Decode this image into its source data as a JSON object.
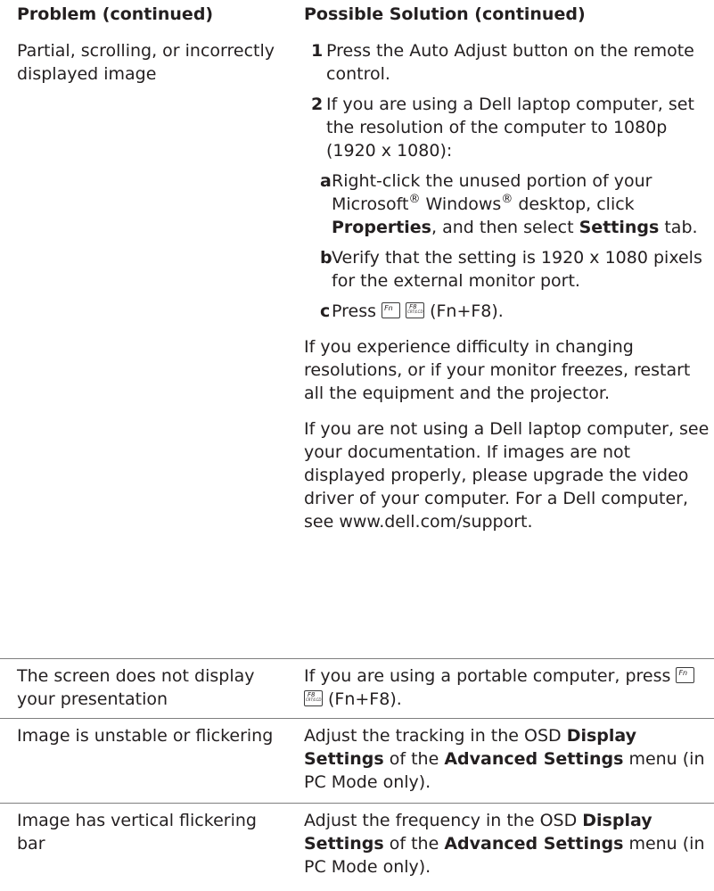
{
  "headers": {
    "problem": "Problem (continued)",
    "solution": "Possible Solution (continued)"
  },
  "rows": [
    {
      "problem": "Partial, scrolling, or incorrectly displayed image",
      "steps": [
        {
          "num": "1",
          "text": "Press the Auto Adjust button on the remote control."
        },
        {
          "num": "2",
          "text": "If you are using a Dell laptop computer, set the resolution of the computer to 1080p (1920 x 1080):"
        }
      ],
      "substeps": {
        "a": {
          "letter": "a",
          "t1": "Right-click the unused portion of your Microsoft",
          "reg": "®",
          "t2": " Windows",
          "t3": " desktop, click ",
          "b1": "Properties",
          "t4": ", and then select ",
          "b2": "Settings",
          "t5": " tab."
        },
        "b": {
          "letter": "b",
          "text": "Verify that the setting is 1920 x 1080 pixels for the external monitor port."
        },
        "c": {
          "letter": "c",
          "pre": "Press",
          "post": "(Fn+F8)."
        }
      },
      "paragraphs": [
        "If you experience difficulty in changing resolutions, or if your monitor freezes, restart all the equipment and the projector.",
        "If you are not using a Dell laptop computer, see your documentation. If images are not displayed properly, please upgrade the video driver of your computer. For a Dell computer, see www.dell.com/support."
      ]
    },
    {
      "problem": "The screen does not display your presentation",
      "pre": "If you are using a portable computer, press",
      "post": "(Fn+F8)."
    },
    {
      "problem": "Image is unstable or flickering",
      "t1": "Adjust the tracking in the OSD ",
      "b1": "Display Settings",
      "t2": " of the ",
      "b2": "Advanced Settings",
      "t3": " menu (in PC Mode only)."
    },
    {
      "problem": "Image has vertical flickering bar",
      "t1": "Adjust the frequency in the OSD ",
      "b1": "Display Settings",
      "t2": " of the ",
      "b2": "Advanced Settings",
      "t3": " menu (in PC Mode only)."
    }
  ],
  "keys": {
    "fn": "fn-key-icon",
    "f8": "f8-crt-lcd-key-icon"
  }
}
